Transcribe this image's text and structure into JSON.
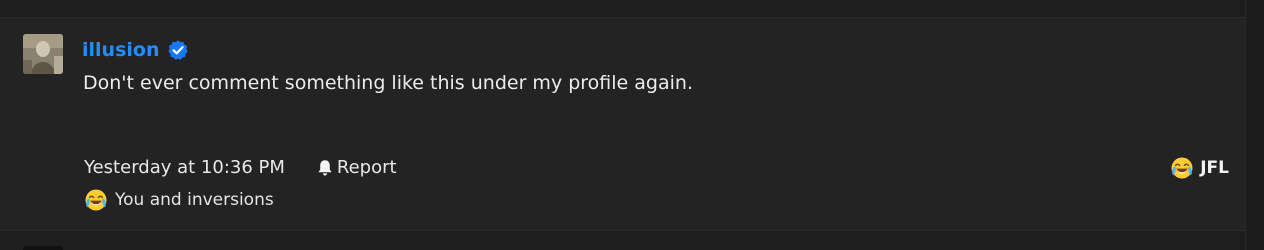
{
  "comment": {
    "author": "illusion",
    "text": "Don't ever comment something like this under my profile again.",
    "timestamp": "Yesterday at 10:36 PM",
    "report_label": "Report",
    "reaction": {
      "icon": "crying-laughing-emoji-icon",
      "label": "JFL"
    },
    "reply": {
      "icon": "crying-laughing-emoji-icon",
      "text": "You and inversions"
    }
  },
  "colors": {
    "background": "#1e1e1e",
    "card": "#232323",
    "author": "#1f8fff",
    "verified_badge": "#1877f2"
  }
}
